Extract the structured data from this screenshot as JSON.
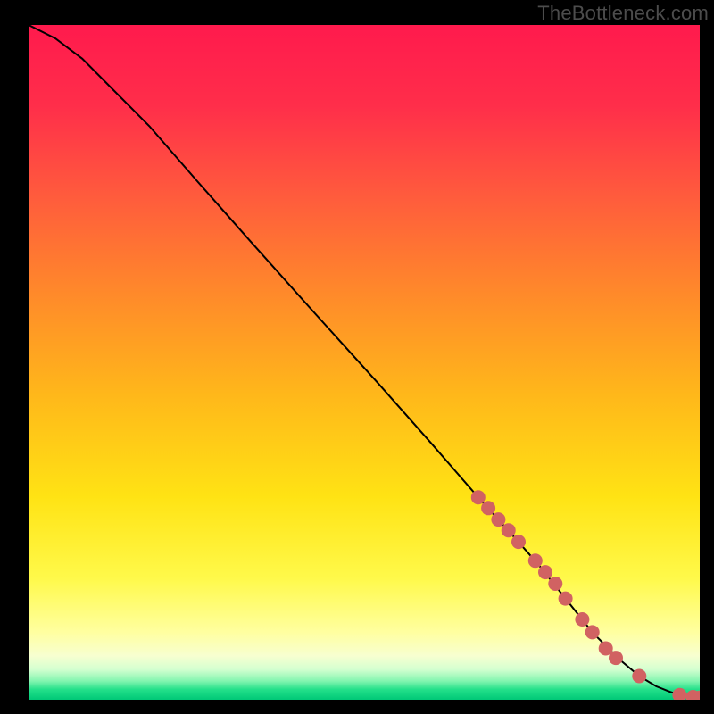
{
  "watermark": "TheBottleneck.com",
  "colors": {
    "line": "#000000",
    "marker_fill": "#d16262",
    "marker_stroke": "#9e3d3d"
  },
  "gradient_stops": [
    {
      "offset": 0.0,
      "color": "#ff1a4d"
    },
    {
      "offset": 0.12,
      "color": "#ff2e4a"
    },
    {
      "offset": 0.25,
      "color": "#ff5a3d"
    },
    {
      "offset": 0.4,
      "color": "#ff8a2a"
    },
    {
      "offset": 0.55,
      "color": "#ffb81a"
    },
    {
      "offset": 0.7,
      "color": "#ffe314"
    },
    {
      "offset": 0.82,
      "color": "#fff94a"
    },
    {
      "offset": 0.9,
      "color": "#ffffa0"
    },
    {
      "offset": 0.935,
      "color": "#f7ffd0"
    },
    {
      "offset": 0.955,
      "color": "#d4ffd0"
    },
    {
      "offset": 0.972,
      "color": "#84f5b0"
    },
    {
      "offset": 0.985,
      "color": "#23e08a"
    },
    {
      "offset": 1.0,
      "color": "#00c877"
    }
  ],
  "chart_data": {
    "type": "line",
    "title": "",
    "xlabel": "",
    "ylabel": "",
    "xlim": [
      0,
      100
    ],
    "ylim": [
      0,
      100
    ],
    "series": [
      {
        "name": "curve",
        "x": [
          0,
          4,
          8,
          12,
          18,
          25,
          33,
          42,
          52,
          60,
          67,
          72,
          76,
          80,
          84,
          88,
          91,
          93.5,
          95.5,
          97,
          98.5,
          100
        ],
        "y": [
          100,
          98,
          95,
          91,
          85,
          77,
          68,
          58,
          47,
          38,
          30,
          24.5,
          20,
          15,
          10,
          6,
          3.5,
          2.0,
          1.2,
          0.7,
          0.4,
          0.3
        ]
      }
    ],
    "markers": {
      "x": [
        67,
        68.5,
        70,
        71.5,
        73,
        75.5,
        77,
        78.5,
        80,
        82.5,
        84,
        86,
        87.5,
        91,
        97,
        99,
        100
      ],
      "y": [
        30,
        28.4,
        26.7,
        25.1,
        23.4,
        20.6,
        18.9,
        17.2,
        15.0,
        11.9,
        10.0,
        7.6,
        6.2,
        3.5,
        0.7,
        0.4,
        0.3
      ]
    }
  }
}
